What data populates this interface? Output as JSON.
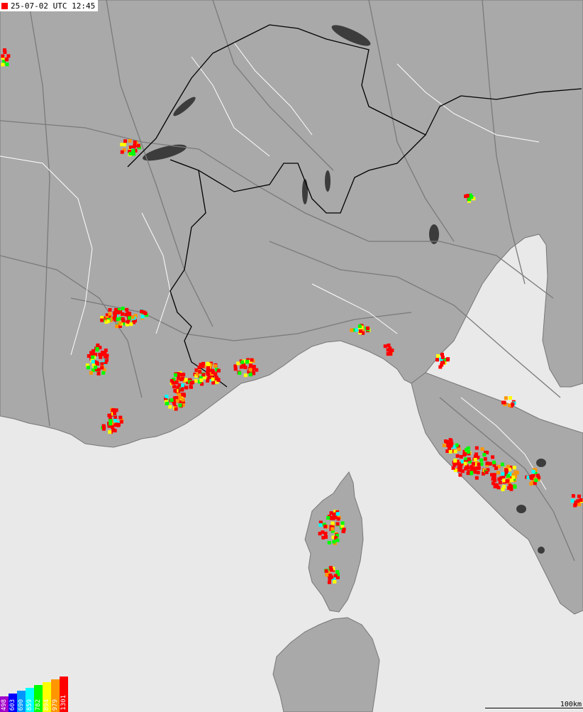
{
  "timestamp": "25-07-02 UTC 12:45",
  "legend": [
    {
      "label": "498",
      "color": "#a000c8"
    },
    {
      "label": "603",
      "color": "#0000ff"
    },
    {
      "label": "690",
      "color": "#0096ff"
    },
    {
      "label": "859",
      "color": "#00ffff"
    },
    {
      "label": "782",
      "color": "#00ff00"
    },
    {
      "label": "894",
      "color": "#ffff00"
    },
    {
      "label": "979",
      "color": "#ff9600"
    },
    {
      "label": "1301",
      "color": "#ff0000"
    }
  ],
  "scale_label": "100km",
  "colors": {
    "sea": "#e9e9e9",
    "land": "#a9a9a9",
    "lake": "#3c3c3c",
    "border": "#000000",
    "road": "#7a7a7a",
    "region": "#ffffff"
  }
}
